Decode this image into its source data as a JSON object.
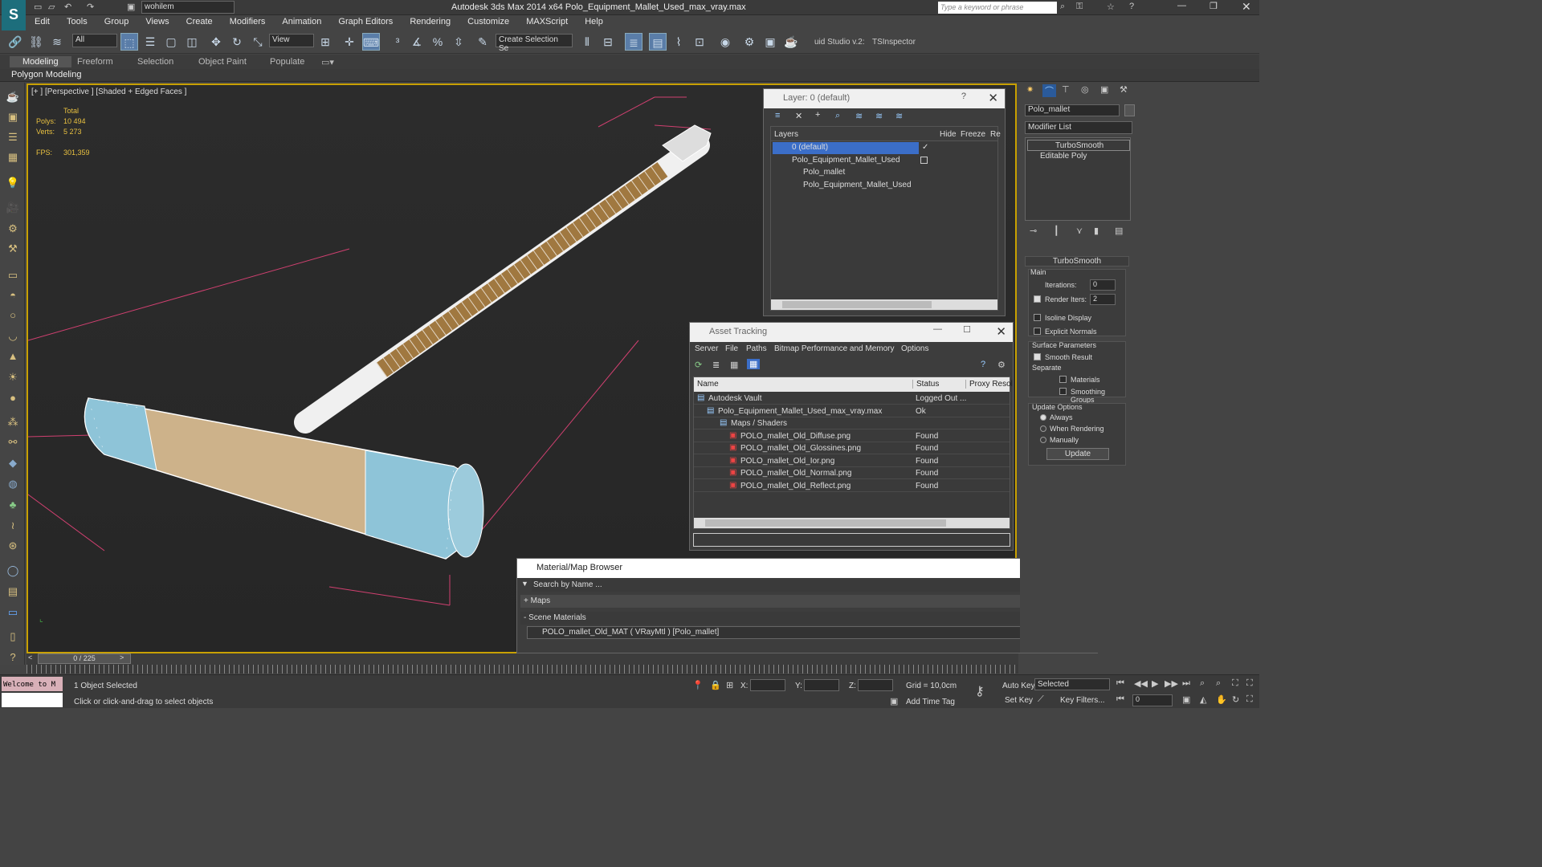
{
  "app": {
    "title": "Autodesk 3ds Max  2014 x64    Polo_Equipment_Mallet_Used_max_vray.max",
    "workspace": "wohilem",
    "search_placeholder": "Type a keyword or phrase"
  },
  "menu": [
    "Edit",
    "Tools",
    "Group",
    "Views",
    "Create",
    "Modifiers",
    "Animation",
    "Graph Editors",
    "Rendering",
    "Customize",
    "MAXScript",
    "Help"
  ],
  "toolbar": {
    "filter": "All",
    "refcoord": "View",
    "selset": "Create Selection Se",
    "ext1": "uid Studio v.2:",
    "ext2": "TSInspector"
  },
  "ribbon": {
    "tabs": [
      "Modeling",
      "Freeform",
      "Selection",
      "Object Paint",
      "Populate"
    ],
    "sub": "Polygon Modeling"
  },
  "viewport": {
    "label": "[+ ] [Perspective ] [Shaded + Edged Faces ]",
    "stats": {
      "total": "Total",
      "polys_label": "Polys:",
      "polys": "10 494",
      "verts_label": "Verts:",
      "verts": "5 273",
      "fps_label": "FPS:",
      "fps": "301,359"
    }
  },
  "layer_win": {
    "title": "Layer: 0 (default)",
    "cols": [
      "Layers",
      "Hide",
      "Freeze",
      "Re"
    ],
    "rows": [
      "0 (default)",
      "Polo_Equipment_Mallet_Used",
      "Polo_mallet",
      "Polo_Equipment_Mallet_Used"
    ]
  },
  "asset_win": {
    "title": "Asset Tracking",
    "menu": [
      "Server",
      "File",
      "Paths",
      "Bitmap Performance and Memory",
      "Options"
    ],
    "cols": [
      "Name",
      "Status",
      "Proxy Resol"
    ],
    "rows": [
      {
        "name": "Autodesk Vault",
        "status": "Logged Out ..."
      },
      {
        "name": "Polo_Equipment_Mallet_Used_max_vray.max",
        "status": "Ok"
      },
      {
        "name": "Maps / Shaders",
        "status": ""
      },
      {
        "name": "POLO_mallet_Old_Diffuse.png",
        "status": "Found"
      },
      {
        "name": "POLO_mallet_Old_Glossines.png",
        "status": "Found"
      },
      {
        "name": "POLO_mallet_Old_Ior.png",
        "status": "Found"
      },
      {
        "name": "POLO_mallet_Old_Normal.png",
        "status": "Found"
      },
      {
        "name": "POLO_mallet_Old_Reflect.png",
        "status": "Found"
      }
    ]
  },
  "mat_win": {
    "title": "Material/Map Browser",
    "search": "Search by Name ...",
    "maps": "+ Maps",
    "scene": "- Scene Materials",
    "material": "POLO_mallet_Old_MAT  ( VRayMtl )  [Polo_mallet]"
  },
  "command_panel": {
    "object_name": "Polo_mallet",
    "modifier_list": "Modifier List",
    "stack": [
      "TurboSmooth",
      "Editable Poly"
    ],
    "rollout": "TurboSmooth",
    "main": "Main",
    "iterations_label": "Iterations:",
    "iterations": "0",
    "render_iters_label": "Render Iters:",
    "render_iters": "2",
    "isoline": "Isoline Display",
    "explicit": "Explicit Normals",
    "surface": "Surface Parameters",
    "smooth_result": "Smooth Result",
    "separate": "Separate",
    "materials": "Materials",
    "smoothing_groups": "Smoothing Groups",
    "update_options": "Update Options",
    "always": "Always",
    "when_rendering": "When Rendering",
    "manually": "Manually",
    "update_btn": "Update"
  },
  "timeline": {
    "frame": "0 / 225"
  },
  "status": {
    "welcome": "Welcome to M",
    "selected": "1 Object Selected",
    "hint": "Click or click-and-drag to select objects",
    "x": "X:",
    "y": "Y:",
    "z": "Z:",
    "grid": "Grid = 10,0cm",
    "add_time_tag": "Add Time Tag",
    "auto_key": "Auto Key",
    "set_key": "Set Key",
    "sel_mode": "Selected",
    "key_filters": "Key Filters...",
    "frame": "0"
  }
}
